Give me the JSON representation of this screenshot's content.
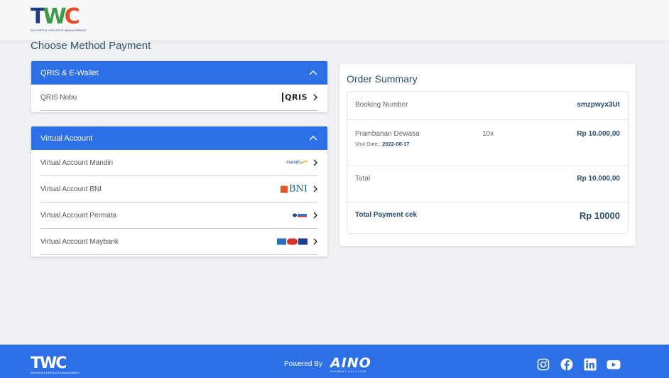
{
  "header": {
    "logo_text": "TWC",
    "logo_subtitle": "INDONESIA HERITAGE MANAGEMENT"
  },
  "page_title": "Choose Method Payment",
  "qris_panel": {
    "title": "QRIS & E-Wallet",
    "items": [
      {
        "label": "QRIS Nobu",
        "logo": "QRIS"
      }
    ]
  },
  "va_panel": {
    "title": "Virtual Account",
    "items": [
      {
        "label": "Virtual Account Mandiri",
        "logo": "mandiri"
      },
      {
        "label": "Virtual Account BNI",
        "logo": "BNI"
      },
      {
        "label": "Virtual Account Permata",
        "logo": "permata"
      },
      {
        "label": "Virtual Account Maybank",
        "logo": "ATM ALTO PRIMA"
      }
    ]
  },
  "summary": {
    "title": "Order Summary",
    "booking_label": "Booking Number",
    "booking_value": "smzpwyx3Ut",
    "item_name": "Prambanan Dewasa",
    "item_qty": "10x",
    "item_price": "Rp 10.000,00",
    "visit_date_label": "Visit Date :",
    "visit_date_value": "2022-08-17",
    "total_label": "Total",
    "total_value": "Rp 10.000,00",
    "total_payment_label": "Total Payment cek",
    "total_payment_value": "Rp 10000"
  },
  "footer": {
    "logo_text": "TWC",
    "logo_subtitle": "INDONESIA HERITAGE MANAGEMENT",
    "powered_by": "Powered By",
    "aino_text": "AINO",
    "aino_subtitle": "PAYMENT SOLUTION",
    "social_icons": [
      "instagram-icon",
      "facebook-icon",
      "linkedin-icon",
      "youtube-icon"
    ]
  },
  "colors": {
    "primary": "#2d6fe6",
    "heading": "#2f4f6f",
    "accent_text": "#2a4e75"
  }
}
